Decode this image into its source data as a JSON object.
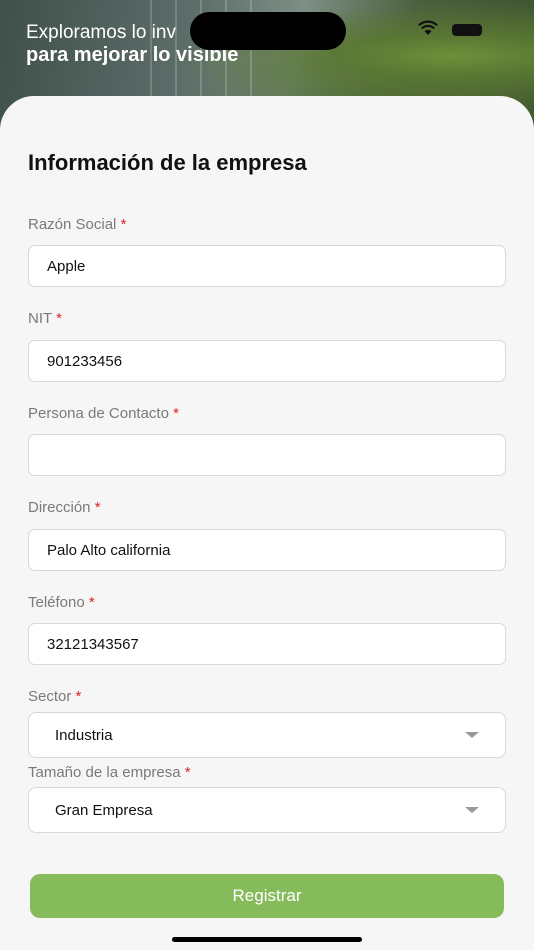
{
  "hero": {
    "line1": "Exploramos lo inv",
    "line2": "para mejorar lo visible"
  },
  "form": {
    "title": "Información de la empresa",
    "required_mark": "*",
    "fields": [
      {
        "label": "Razón Social",
        "value": "Apple"
      },
      {
        "label": "NIT",
        "value": "901233456"
      },
      {
        "label": "Persona de Contacto",
        "value": ""
      },
      {
        "label": "Dirección",
        "value": "Palo Alto california"
      },
      {
        "label": "Teléfono",
        "value": "32121343567"
      }
    ],
    "selects": [
      {
        "label": "Sector",
        "value": "Industria"
      },
      {
        "label": "Tamaño de la empresa",
        "value": "Gran Empresa"
      }
    ],
    "submit_label": "Registrar"
  },
  "colors": {
    "accent": "#86bb5b",
    "required": "#dd2222"
  },
  "icons": [
    "wifi-icon",
    "battery-icon",
    "chevron-down-icon"
  ]
}
